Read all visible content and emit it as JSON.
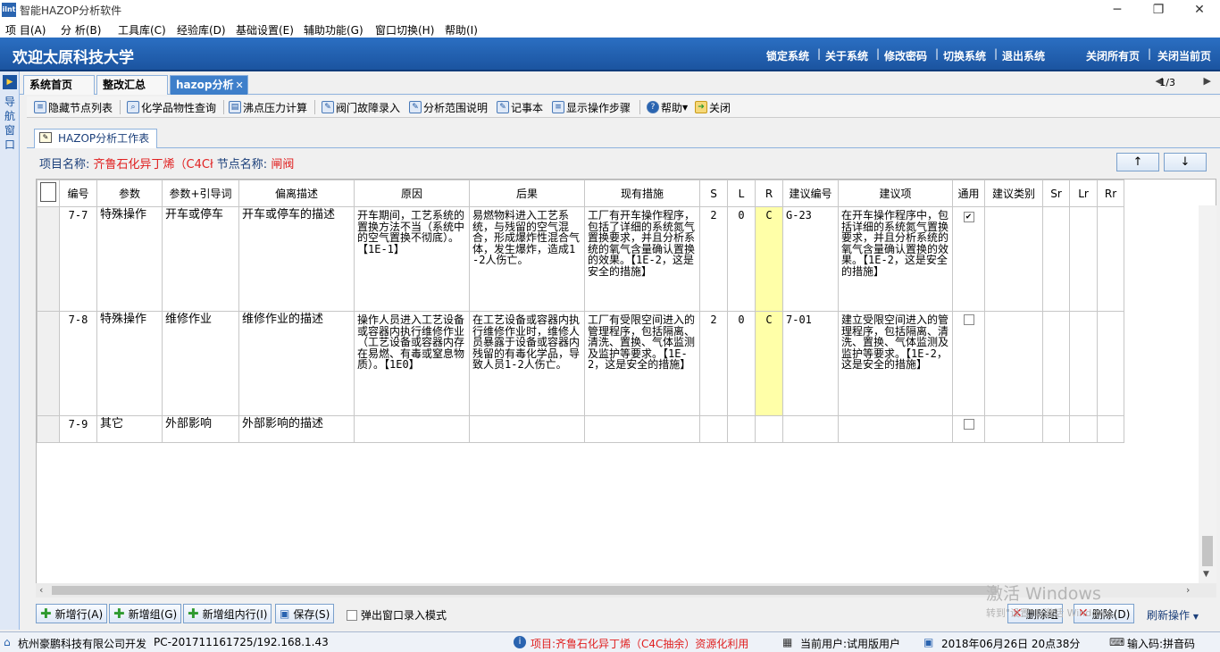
{
  "titlebar": {
    "title": "智能HAZOP分析软件",
    "app_icon_text": "ilnt"
  },
  "menu": [
    "项 目(A)",
    "分 析(B)",
    "工具库(C)",
    "经验库(D)",
    "基础设置(E)",
    "辅助功能(G)",
    "窗口切换(H)",
    "帮助(I)"
  ],
  "banner": {
    "welcome": "欢迎太原科技大学",
    "links": [
      "锁定系统",
      "关于系统",
      "修改密码",
      "切换系统",
      "退出系统"
    ],
    "right_links": [
      "关闭所有页",
      "关闭当前页"
    ]
  },
  "leftnav": {
    "text": "导航窗口"
  },
  "tabs": [
    {
      "label": "系统首页"
    },
    {
      "label": "整改汇总"
    },
    {
      "label": "hazop分析"
    }
  ],
  "tab_pager": "1/3",
  "toolbar": [
    {
      "label": "隐藏节点列表",
      "icon": "list-icon"
    },
    {
      "label": "化学品物性查询",
      "icon": "search-icon"
    },
    {
      "label": "沸点压力计算",
      "icon": "calc-icon"
    },
    {
      "label": "阀门故障录入",
      "icon": "edit-icon"
    },
    {
      "label": "分析范围说明",
      "icon": "edit-icon"
    },
    {
      "label": "记事本",
      "icon": "notepad-icon"
    },
    {
      "label": "显示操作步骤",
      "icon": "steps-icon"
    },
    {
      "label": "帮助",
      "icon": "help-icon"
    },
    {
      "label": "关闭",
      "icon": "close-icon"
    }
  ],
  "worksheet": {
    "tab": "HAZOP分析工作表",
    "project_label": "项目名称:",
    "project_name": "齐鲁石化异丁烯（C4Cł",
    "node_label": "节点名称:",
    "node_name": "闸阀",
    "up_arrow": "↑",
    "down_arrow": "↓"
  },
  "table": {
    "columns": [
      "编号",
      "参数",
      "参数+引导词",
      "偏离描述",
      "原因",
      "后果",
      "现有措施",
      "S",
      "L",
      "R",
      "建议编号",
      "建议项",
      "通用",
      "建议类别",
      "Sr",
      "Lr",
      "Rr"
    ],
    "rows": [
      {
        "id": "7-7",
        "param": "特殊操作",
        "guide": "开车或停车",
        "deviation": "开车或停车的描述",
        "cause": "开车期间，工艺系统的置换方法不当（系统中的空气置换不彻底）。【1E-1】",
        "consequence": "易燃物料进入工艺系统，与残留的空气混合，形成爆炸性混合气体，发生爆炸，造成1-2人伤亡。",
        "measures": "工厂有开车操作程序，包括了详细的系统氮气置换要求，并且分析系统的氧气含量确认置换的效果。【1E-2，这是安全的措施】",
        "S": "2",
        "L": "0",
        "R": "C",
        "rec_id": "G-23",
        "recommendation": "在开车操作程序中，包括详细的系统氮气置换要求，并且分析系统的氧气含量确认置换的效果。【1E-2，这是安全的措施】",
        "general": true,
        "rec_type": "",
        "Sr": "",
        "Lr": "",
        "Rr": ""
      },
      {
        "id": "7-8",
        "param": "特殊操作",
        "guide": "维修作业",
        "deviation": "维修作业的描述",
        "cause": "操作人员进入工艺设备或容器内执行维修作业（工艺设备或容器内存在易燃、有毒或窒息物质）。【1E0】",
        "consequence": "在工艺设备或容器内执行维修作业时，维修人员暴露于设备或容器内残留的有毒化学品，导致人员1-2人伤亡。",
        "measures": "工厂有受限空间进入的管理程序，包括隔离、清洗、置换、气体监测及监护等要求。【1E-2，这是安全的措施】",
        "S": "2",
        "L": "0",
        "R": "C",
        "rec_id": "7-01",
        "recommendation": "建立受限空间进入的管理程序，包括隔离、清洗、置换、气体监测及监护等要求。【1E-2，这是安全的措施】",
        "general": false,
        "rec_type": "",
        "Sr": "",
        "Lr": "",
        "Rr": ""
      },
      {
        "id": "7-9",
        "param": "其它",
        "guide": "外部影响",
        "deviation": "外部影响的描述",
        "cause": "",
        "consequence": "",
        "measures": "",
        "S": "",
        "L": "",
        "R": "",
        "rec_id": "",
        "recommendation": "",
        "general": false,
        "rec_type": "",
        "Sr": "",
        "Lr": "",
        "Rr": ""
      }
    ]
  },
  "bottom": {
    "add_row": "新增行(A)",
    "add_group": "新增组(G)",
    "add_row_in_group": "新增组内行(I)",
    "save": "保存(S)",
    "popup_mode": "弹出窗口录入模式",
    "delete_group": "删除组",
    "delete": "删除(D)",
    "refresh": "刷新操作"
  },
  "watermark": {
    "line1": "激活 Windows",
    "line2": "转到\"设置\"以激活 Windows。"
  },
  "status": {
    "company": "杭州豪鹏科技有限公司开发",
    "pc": "PC-201711161725/192.168.1.43",
    "project": "项目:齐鲁石化异丁烯（C4C抽余）资源化利用",
    "user": "当前用户:试用版用户",
    "datetime": "2018年06月26日 20点38分",
    "ime": "输入码:拼音码"
  }
}
